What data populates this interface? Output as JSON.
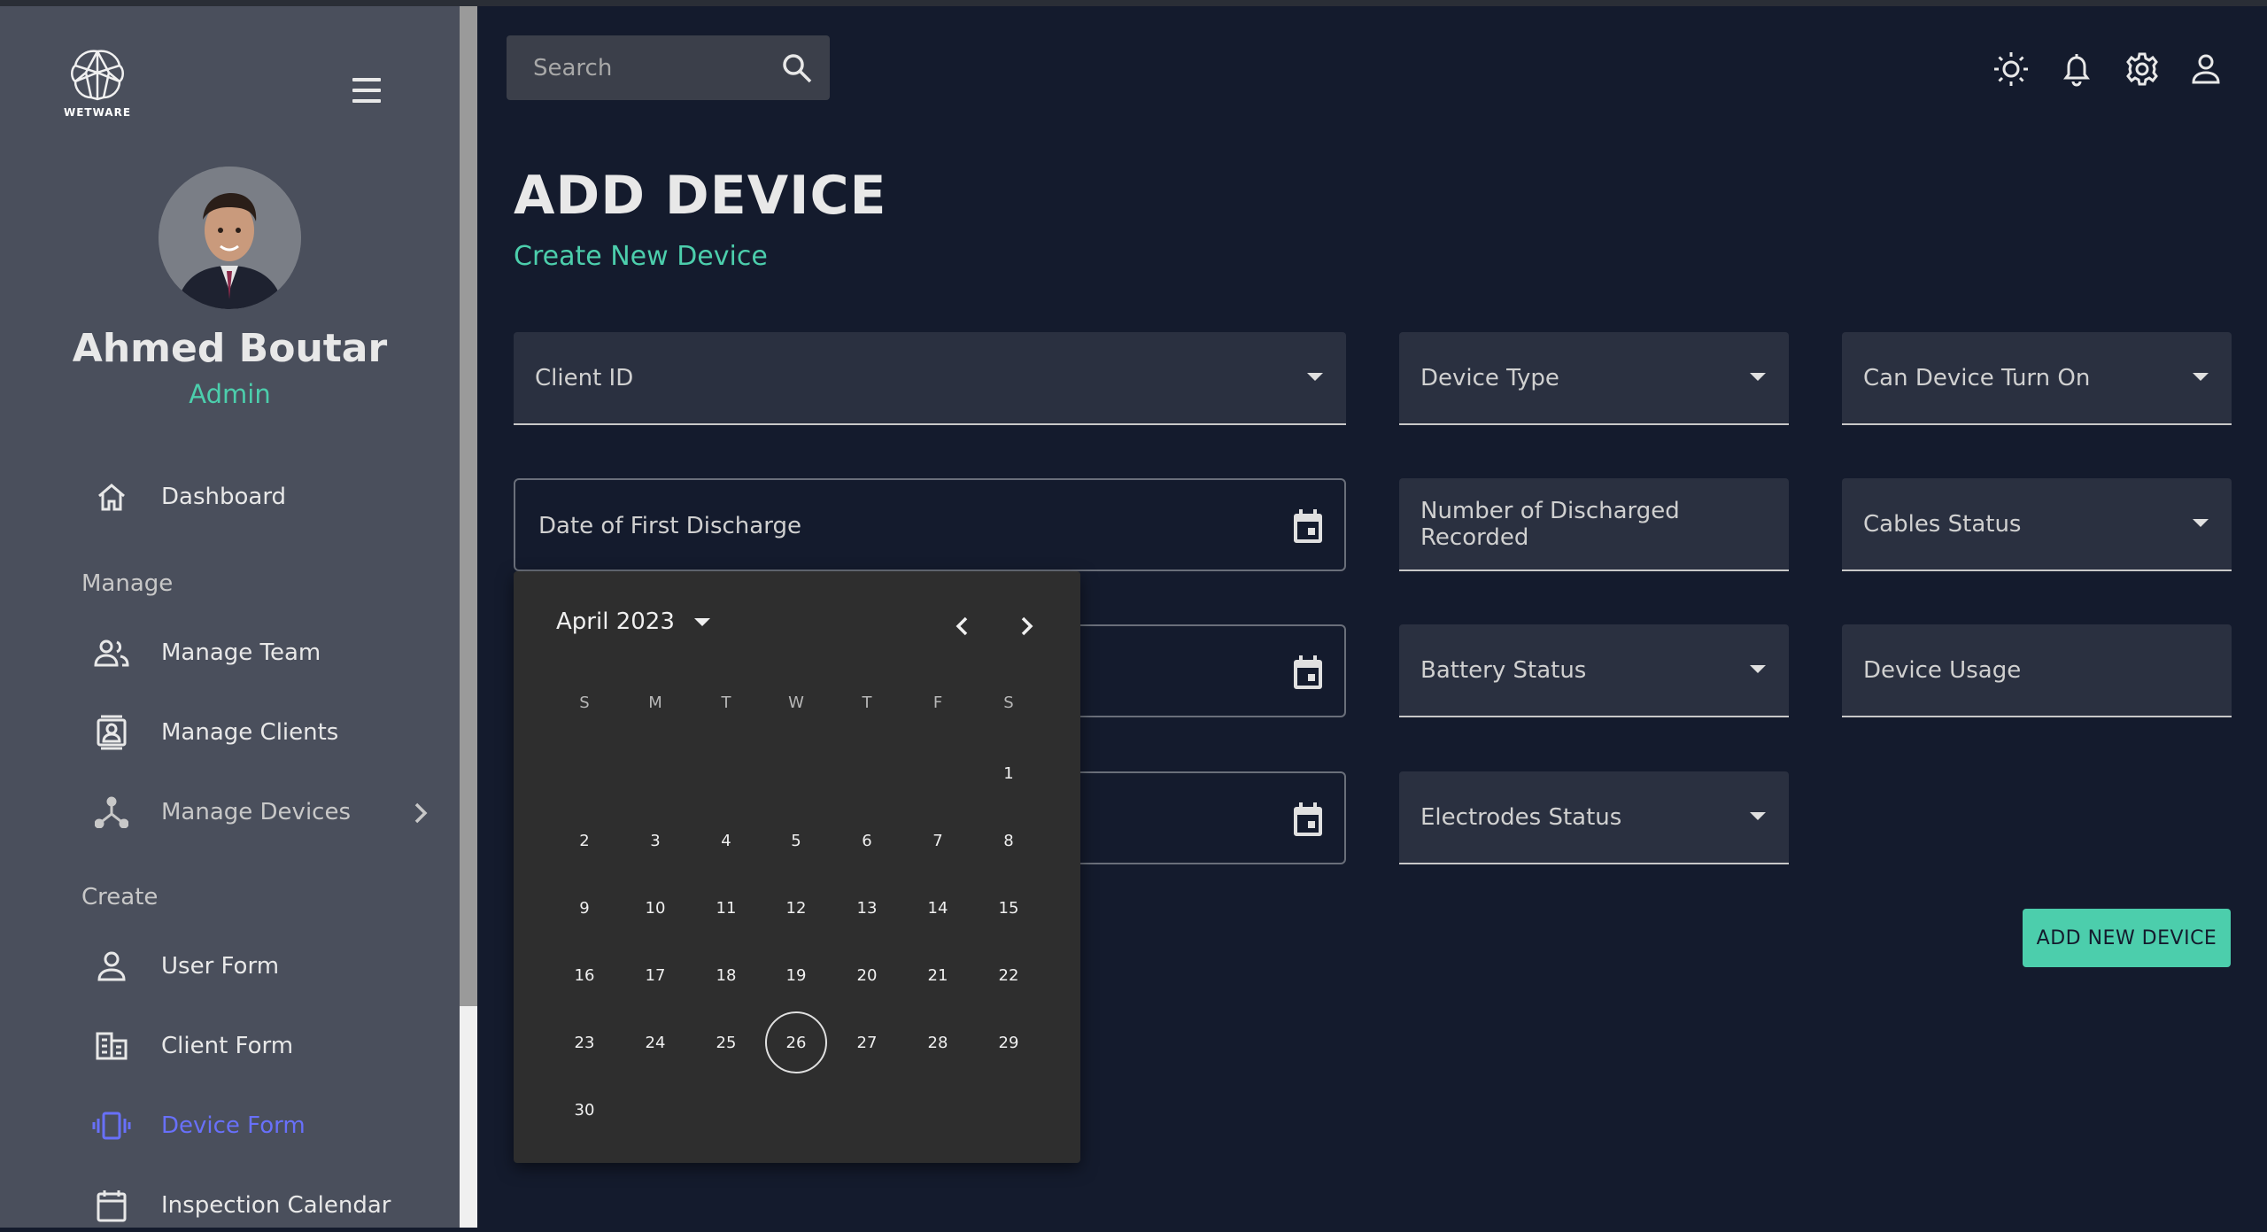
{
  "brand": {
    "logo_text": "WETWARE"
  },
  "user": {
    "name": "Ahmed Boutar",
    "role": "Admin"
  },
  "sidebar": {
    "items": [
      {
        "label": "Dashboard"
      },
      {
        "section": "Manage"
      },
      {
        "label": "Manage Team"
      },
      {
        "label": "Manage Clients"
      },
      {
        "label": "Manage Devices"
      },
      {
        "section": "Create"
      },
      {
        "label": "User Form"
      },
      {
        "label": "Client Form"
      },
      {
        "label": "Device Form"
      },
      {
        "label": "Inspection Calendar"
      }
    ]
  },
  "search": {
    "placeholder": "Search"
  },
  "page": {
    "title": "ADD DEVICE",
    "subtitle": "Create New Device"
  },
  "form": {
    "client_id": "Client ID",
    "device_type": "Device Type",
    "can_turn_on": "Can Device Turn On",
    "date_first_discharge": "Date of First Discharge",
    "num_discharged": "Number of Discharged Recorded",
    "cables_status": "Cables Status",
    "battery_status": "Battery Status",
    "device_usage": "Device Usage",
    "electrodes_status": "Electrodes Status",
    "submit": "ADD NEW DEVICE"
  },
  "calendar": {
    "month_label": "April 2023",
    "weekdays": [
      "S",
      "M",
      "T",
      "W",
      "T",
      "F",
      "S"
    ],
    "days": [
      "1",
      "2",
      "3",
      "4",
      "5",
      "6",
      "7",
      "8",
      "9",
      "10",
      "11",
      "12",
      "13",
      "14",
      "15",
      "16",
      "17",
      "18",
      "19",
      "20",
      "21",
      "22",
      "23",
      "24",
      "25",
      "26",
      "27",
      "28",
      "29",
      "30"
    ],
    "selected_day": "26"
  },
  "colors": {
    "accent": "#4cceac",
    "active_nav": "#6870fa",
    "background": "#141b2d",
    "sidebar": "#4a4f5c"
  }
}
